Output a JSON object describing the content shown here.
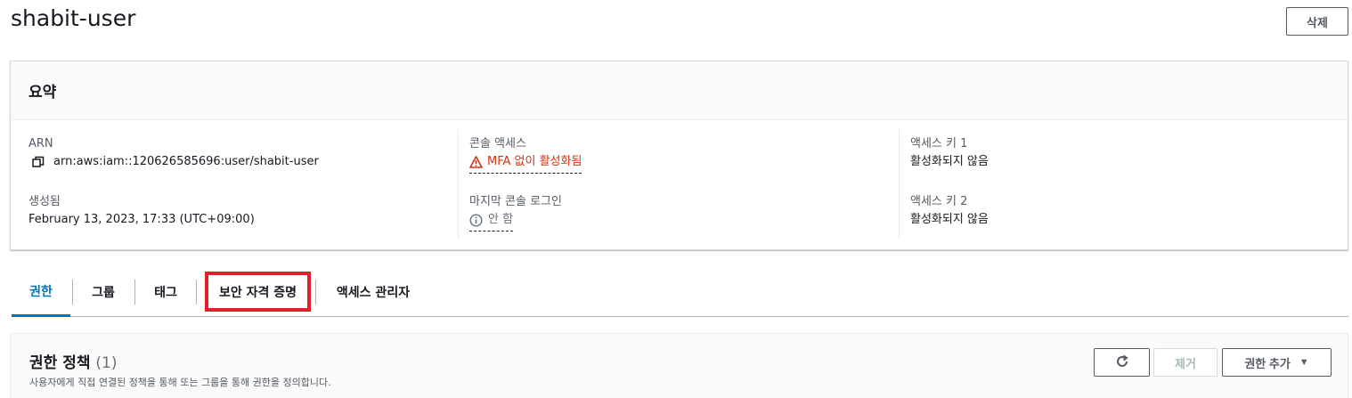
{
  "page": {
    "title": "shabit-user",
    "delete_label": "삭제"
  },
  "summary": {
    "title": "요약",
    "arn": {
      "label": "ARN",
      "value": "arn:aws:iam::120626585696:user/shabit-user"
    },
    "created": {
      "label": "생성됨",
      "value": "February 13, 2023, 17:33 (UTC+09:00)"
    },
    "console_access": {
      "label": "콘솔 액세스",
      "value": "MFA 없이 활성화됨"
    },
    "last_console_login": {
      "label": "마지막 콘솔 로그인",
      "value": "안 함"
    },
    "access_key_1": {
      "label": "액세스 키 1",
      "value": "활성화되지 않음"
    },
    "access_key_2": {
      "label": "액세스 키 2",
      "value": "활성화되지 않음"
    }
  },
  "tabs": [
    {
      "label": "권한",
      "active": true
    },
    {
      "label": "그룹"
    },
    {
      "label": "태그"
    },
    {
      "label": "보안 자격 증명",
      "highlighted": true
    },
    {
      "label": "액세스 관리자"
    }
  ],
  "permissions": {
    "title": "권한 정책",
    "count": "(1)",
    "description": "사용자에게 직접 연결된 정책을 통해 또는 그룹을 통해 권한을 정의합니다.",
    "remove_label": "제거",
    "add_label": "권한 추가"
  },
  "colors": {
    "accent": "#0073bb",
    "warning": "#d13212",
    "highlight": "#e0202a"
  },
  "icons": [
    "copy-icon",
    "warning-icon",
    "info-icon",
    "refresh-icon",
    "caret-down-icon"
  ]
}
